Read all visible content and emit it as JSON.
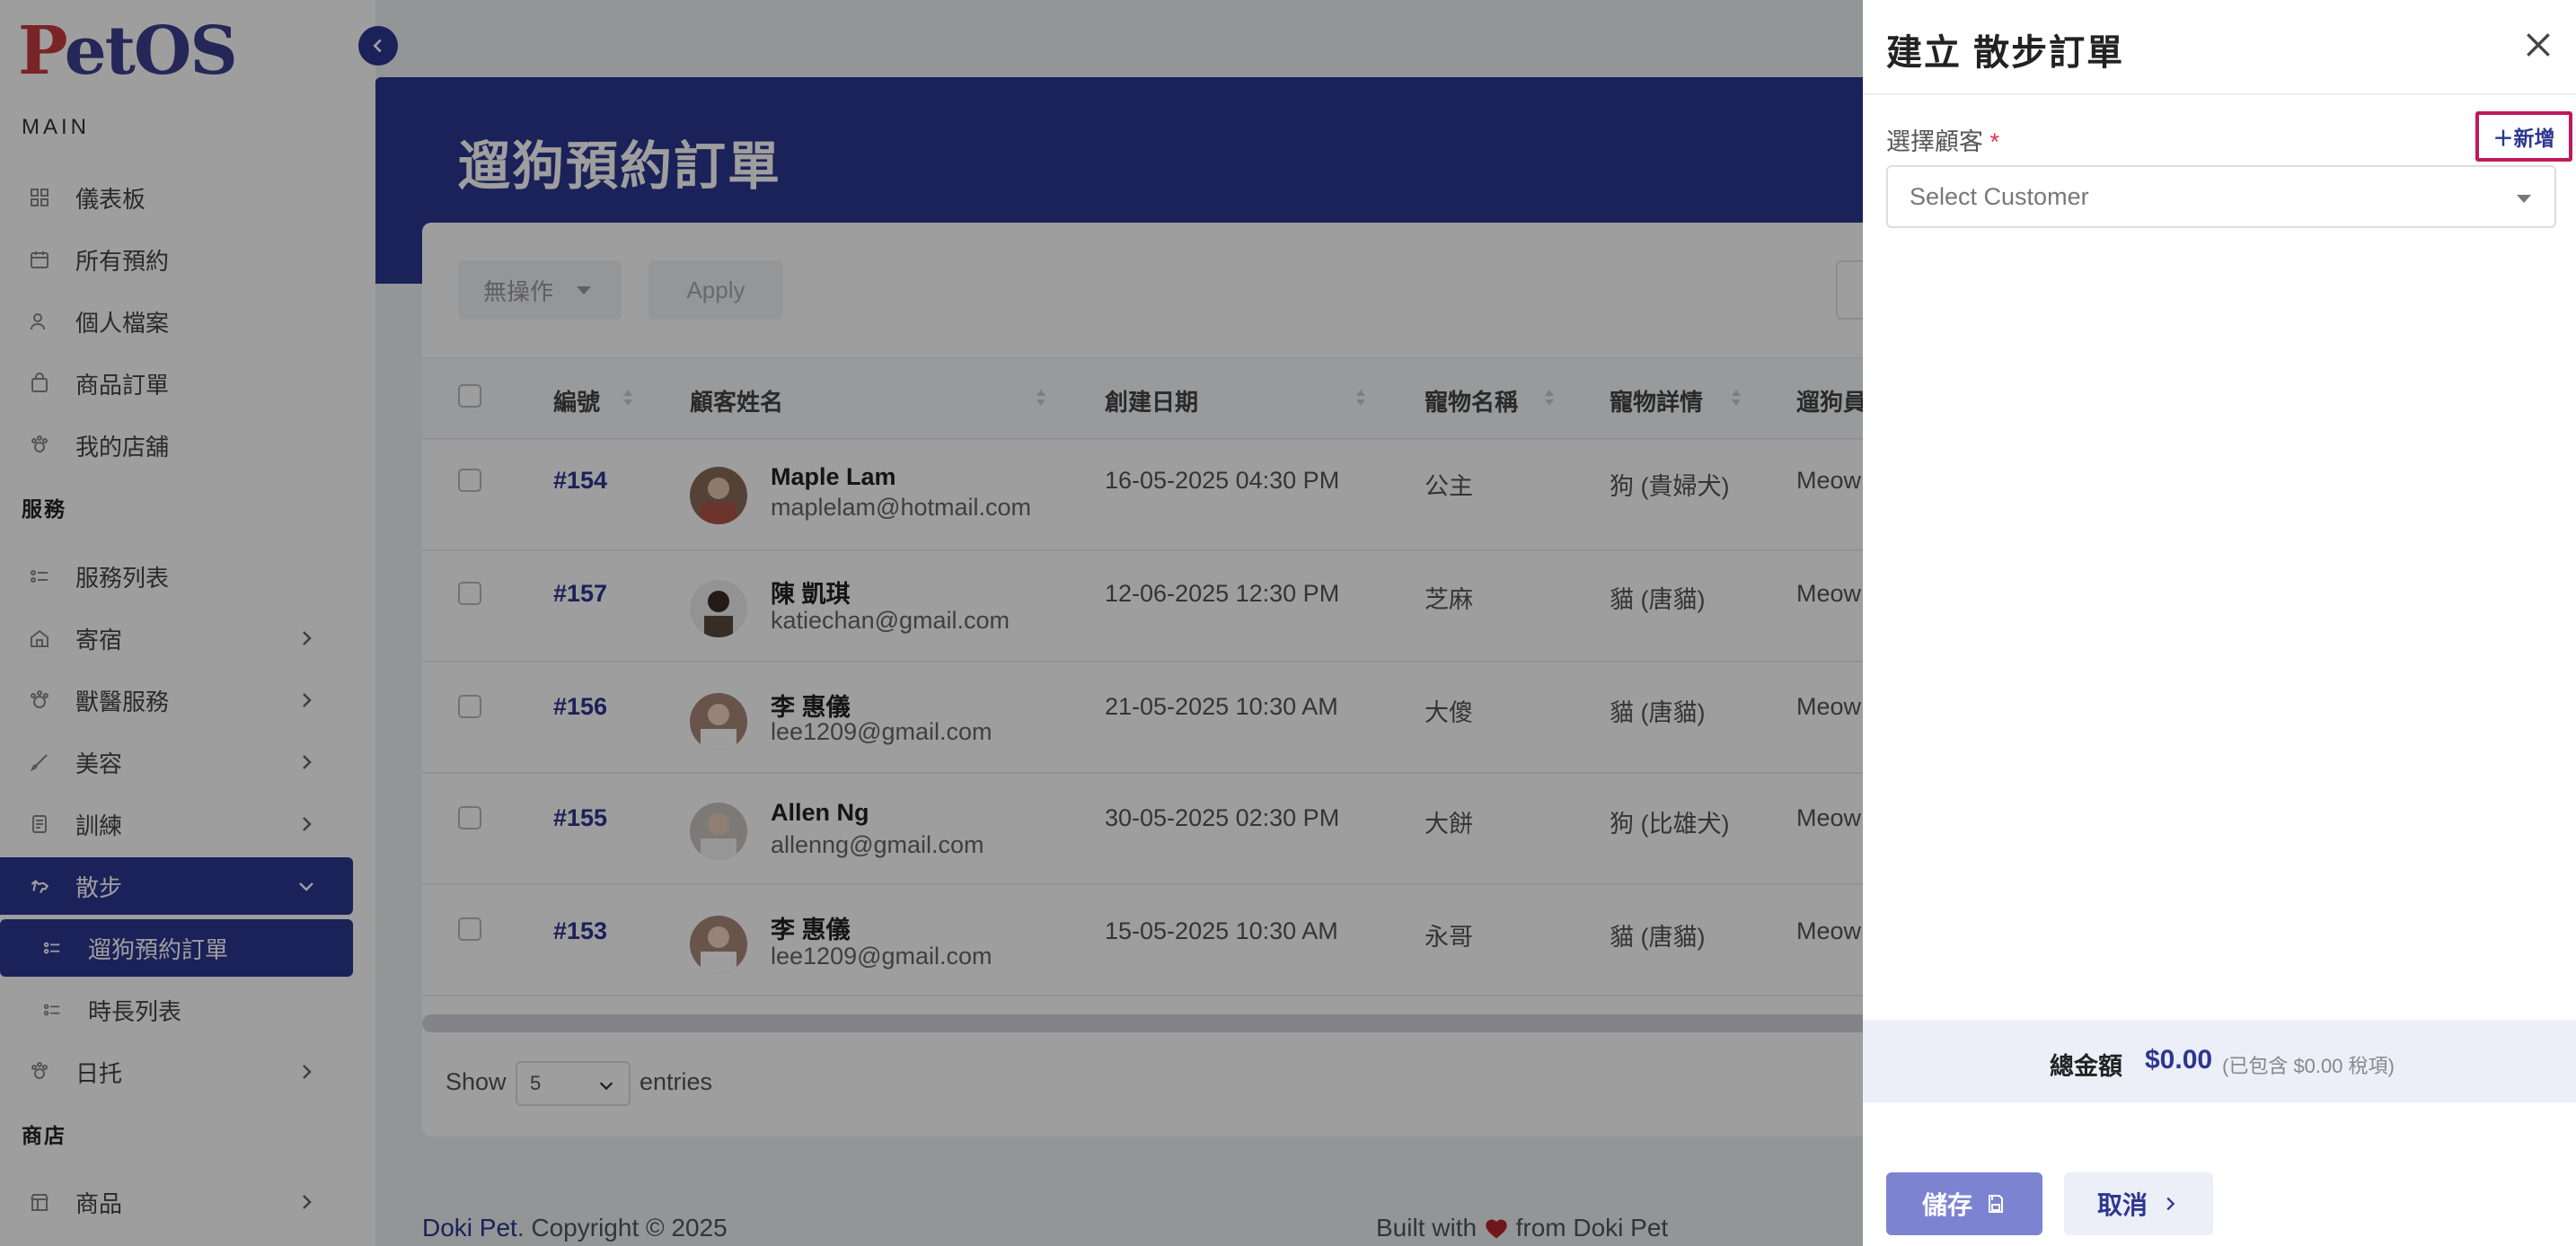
{
  "app": {
    "logo_first": "P",
    "logo_rest": "etOS"
  },
  "sidebar": {
    "main_label": "MAIN",
    "items_main": [
      {
        "label": "儀表板",
        "icon": "grid-icon"
      },
      {
        "label": "所有預約",
        "icon": "calendar-icon"
      },
      {
        "label": "個人檔案",
        "icon": "user-icon"
      },
      {
        "label": "商品訂單",
        "icon": "bag-icon"
      },
      {
        "label": "我的店舖",
        "icon": "paw-shop-icon"
      }
    ],
    "services_label": "服務",
    "items_services": [
      {
        "label": "服務列表",
        "icon": "list-icon"
      },
      {
        "label": "寄宿",
        "icon": "house-icon"
      },
      {
        "label": "獸醫服務",
        "icon": "vet-icon"
      },
      {
        "label": "美容",
        "icon": "brush-icon"
      },
      {
        "label": "訓練",
        "icon": "training-icon"
      },
      {
        "label": "散步",
        "icon": "walk-icon"
      }
    ],
    "walk_sub": [
      {
        "label": "遛狗預約訂單"
      },
      {
        "label": "時長列表"
      }
    ],
    "daycare": {
      "label": "日托",
      "icon": "daycare-icon"
    },
    "shop_label": "商店",
    "items_shop": [
      {
        "label": "商品",
        "icon": "store-icon"
      }
    ]
  },
  "main": {
    "title": "遛狗預約訂單",
    "bulk_action": "無操作",
    "apply_label": "Apply",
    "columns": [
      "編號",
      "顧客姓名",
      "創建日期",
      "寵物名稱",
      "寵物詳情",
      "遛狗員"
    ],
    "rows": [
      {
        "id": "#154",
        "name": "Maple Lam",
        "email": "maplelam@hotmail.com",
        "date": "16-05-2025 04:30 PM",
        "pet": "公主",
        "detail": "狗 (貴婦犬)",
        "walker": "Meow"
      },
      {
        "id": "#157",
        "name": "陳 凱琪",
        "email": "katiechan@gmail.com",
        "date": "12-06-2025 12:30 PM",
        "pet": "芝麻",
        "detail": "貓 (唐貓)",
        "walker": "Meow"
      },
      {
        "id": "#156",
        "name": "李 惠儀",
        "email": "lee1209@gmail.com",
        "date": "21-05-2025 10:30 AM",
        "pet": "大傻",
        "detail": "貓 (唐貓)",
        "walker": "Meow"
      },
      {
        "id": "#155",
        "name": "Allen Ng",
        "email": "allenng@gmail.com",
        "date": "30-05-2025 02:30 PM",
        "pet": "大餅",
        "detail": "狗 (比雄犬)",
        "walker": "Meow"
      },
      {
        "id": "#153",
        "name": "李 惠儀",
        "email": "lee1209@gmail.com",
        "date": "15-05-2025 10:30 AM",
        "pet": "永哥",
        "detail": "貓 (唐貓)",
        "walker": "Meow"
      }
    ],
    "show_label": "Show",
    "entries_value": "5",
    "entries_label": "entries"
  },
  "footer": {
    "brand": "Doki Pet",
    "copyright": ". Copyright © 2025",
    "built_prefix": "Built with",
    "built_suffix": "from Doki Pet"
  },
  "drawer": {
    "title": "建立 散步訂單",
    "customer_label": "選擇顧客",
    "required_mark": "*",
    "add_new": "＋新增",
    "customer_placeholder": "Select Customer",
    "total_label": "總金額",
    "total_amount": "$0.00",
    "tax_note": "(已包含 $0.00 稅項)",
    "save_label": "儲存",
    "cancel_label": "取消"
  },
  "colors": {
    "primary": "#2c3690",
    "accent_red": "#c63a3f",
    "highlight_border": "#c2185b"
  }
}
